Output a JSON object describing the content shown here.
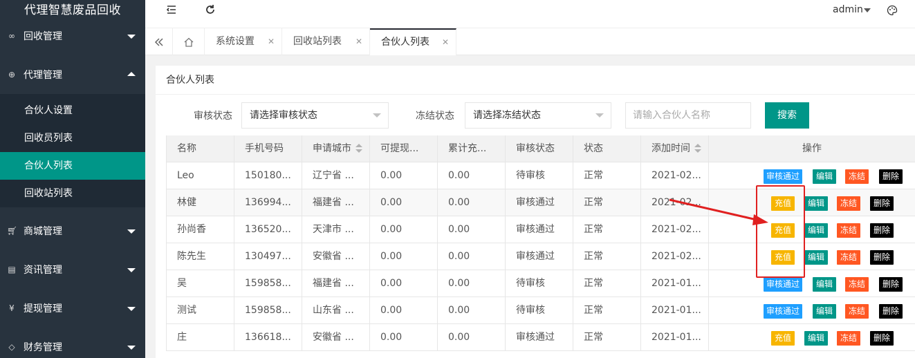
{
  "app": {
    "title": "代理智慧废品回收"
  },
  "sidebar": {
    "groups": [
      {
        "label": "回收管理",
        "icon": "infinity-icon"
      },
      {
        "label": "代理管理",
        "icon": "plus-circle-icon"
      },
      {
        "label": "商城管理",
        "icon": "cart-icon"
      },
      {
        "label": "资讯管理",
        "icon": "document-icon"
      },
      {
        "label": "提现管理",
        "icon": "yen-icon"
      },
      {
        "label": "财务管理",
        "icon": "diamond-icon"
      }
    ],
    "subitems": [
      {
        "label": "合伙人设置"
      },
      {
        "label": "回收员列表"
      },
      {
        "label": "合伙人列表"
      },
      {
        "label": "回收站列表"
      }
    ]
  },
  "header": {
    "user": "admin"
  },
  "tabs": [
    {
      "label": "系统设置"
    },
    {
      "label": "回收站列表"
    },
    {
      "label": "合伙人列表"
    }
  ],
  "page": {
    "title": "合伙人列表"
  },
  "filters": {
    "review_label": "审核状态",
    "review_value": "请选择审核状态",
    "freeze_label": "冻结状态",
    "freeze_value": "请选择冻结状态",
    "name_placeholder": "请输入合伙人名称",
    "search_label": "搜索"
  },
  "table": {
    "headers": [
      "名称",
      "手机号码",
      "申请城市",
      "可提现...",
      "累计充...",
      "审核状态",
      "状态",
      "添加时间",
      "操作"
    ],
    "rows": [
      {
        "name": "Leo",
        "phone": "150180...",
        "city": "辽宁省 ...",
        "withdrawable": "0.00",
        "recharged": "0.00",
        "review": "待审核",
        "status": "正常",
        "added": "2021-02...",
        "first_action": "审核通过"
      },
      {
        "name": "林健",
        "phone": "136994...",
        "city": "福建省 ...",
        "withdrawable": "0.00",
        "recharged": "0.00",
        "review": "审核通过",
        "status": "正常",
        "added": "2021-02...",
        "first_action": "充值"
      },
      {
        "name": "孙尚香",
        "phone": "136520...",
        "city": "天津市 ...",
        "withdrawable": "0.00",
        "recharged": "0.00",
        "review": "审核通过",
        "status": "正常",
        "added": "2021-02...",
        "first_action": "充值"
      },
      {
        "name": "陈先生",
        "phone": "130497...",
        "city": "安徽省 ...",
        "withdrawable": "0.00",
        "recharged": "0.00",
        "review": "审核通过",
        "status": "正常",
        "added": "2021-02...",
        "first_action": "充值"
      },
      {
        "name": "吴",
        "phone": "159858...",
        "city": "福建省 ...",
        "withdrawable": "0.00",
        "recharged": "0.00",
        "review": "待审核",
        "status": "正常",
        "added": "2021-01...",
        "first_action": "审核通过"
      },
      {
        "name": "测试",
        "phone": "159858...",
        "city": "山东省 ...",
        "withdrawable": "0.00",
        "recharged": "0.00",
        "review": "待审核",
        "status": "正常",
        "added": "2021-01...",
        "first_action": "审核通过"
      },
      {
        "name": "庄",
        "phone": "136618...",
        "city": "安徽省 ...",
        "withdrawable": "0.00",
        "recharged": "0.00",
        "review": "审核通过",
        "status": "正常",
        "added": "2021-01...",
        "first_action": "充值"
      }
    ],
    "action_labels": {
      "edit": "编辑",
      "freeze": "冻结",
      "delete": "删除"
    }
  },
  "colors": {
    "sidebar_bg": "#28333e",
    "accent": "#009688",
    "blue": "#1e9fff",
    "yellow": "#f7b500",
    "orange": "#ff5722",
    "annotation": "#e02020"
  }
}
